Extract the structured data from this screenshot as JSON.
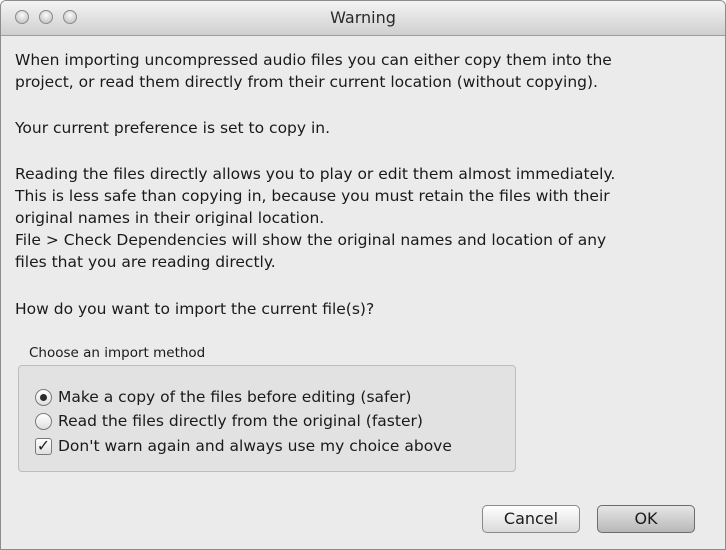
{
  "window": {
    "title": "Warning"
  },
  "message": {
    "paragraph1": [
      "When importing uncompressed audio files you can either copy them into the",
      "project, or read them directly from their current location (without copying)."
    ],
    "paragraph2": "Your current preference is set to copy in.",
    "paragraph3": [
      "Reading the files directly allows you to play or edit them almost immediately.",
      "This is less safe than copying in, because you must retain the files with their",
      "original names in their original location.",
      "File > Check Dependencies will show the original names and location of any",
      "files that you are reading directly."
    ],
    "question": "How do you want to import the current file(s)?"
  },
  "import_method": {
    "group_label": "Choose an import method",
    "options": [
      {
        "label": "Make a copy of the files before editing (safer)",
        "selected": true
      },
      {
        "label": "Read the files directly from the original (faster)",
        "selected": false
      }
    ],
    "dont_warn": {
      "label": "Don't warn again and always use my choice above",
      "checked": true
    }
  },
  "buttons": {
    "cancel": "Cancel",
    "ok": "OK"
  }
}
